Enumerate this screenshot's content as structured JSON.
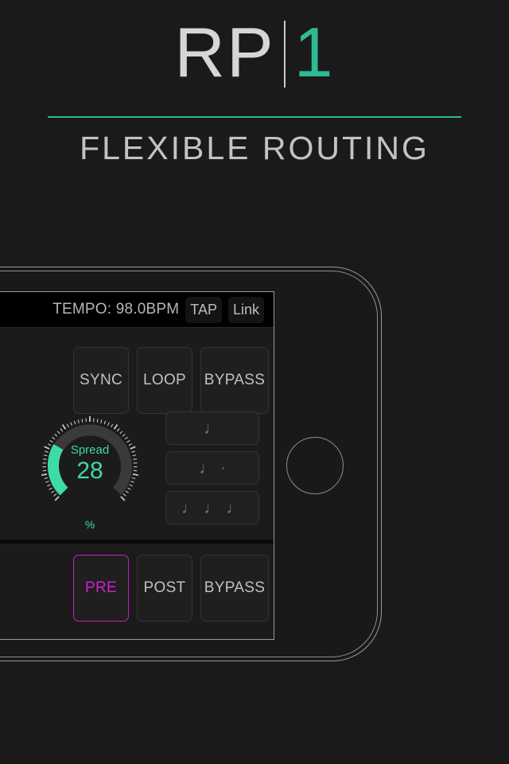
{
  "promo": {
    "logo_main": "RP",
    "logo_accent": "1",
    "subtitle": "FLEXIBLE ROUTING",
    "accent_color": "#2fb996",
    "rule_color": "#2fb996",
    "background_color": "#1a1a1a"
  },
  "app": {
    "tempo_bar": {
      "tempo_text": "TEMPO: 98.0BPM",
      "tap_label": "TAP",
      "link_label": "Link"
    },
    "top_pads": [
      {
        "label": "SYNC",
        "active": false
      },
      {
        "label": "LOOP",
        "active": false
      },
      {
        "label": "BYPASS",
        "active": false
      }
    ],
    "knob": {
      "label": "Spread",
      "value": "28",
      "unit": "%",
      "percent": 28,
      "fill_color": "#3ddba8",
      "track_color": "#3a3a3a",
      "tick_color": "#c9c9c9"
    },
    "note_pads": [
      {
        "glyph": "♩",
        "dotted": "",
        "name": "quarter-note"
      },
      {
        "glyph": "♩",
        "dotted": "·",
        "name": "dotted-quarter-note"
      },
      {
        "glyph": "♩ ♩ ♩",
        "dotted": "",
        "name": "triplet-notes"
      }
    ],
    "bottom_pads": [
      {
        "label": "PRE",
        "active": true
      },
      {
        "label": "POST",
        "active": false
      },
      {
        "label": "BYPASS",
        "active": false
      }
    ],
    "active_color": "#d21fd2"
  }
}
